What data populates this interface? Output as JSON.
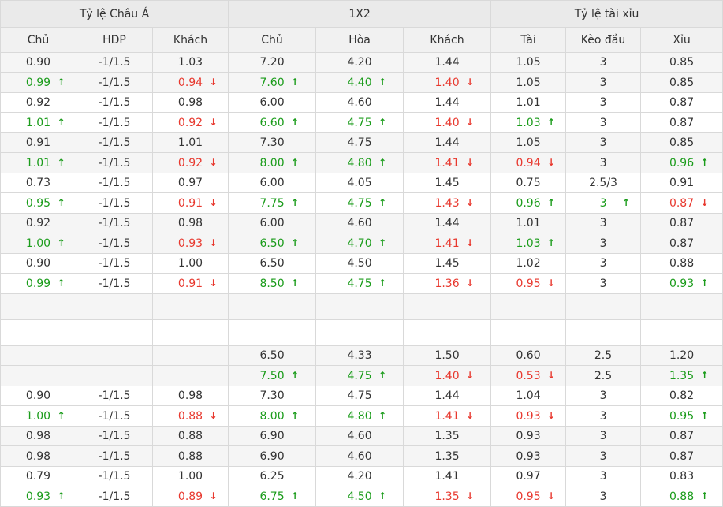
{
  "groups": [
    {
      "label": "Tỷ lệ Châu Á"
    },
    {
      "label": "1X2"
    },
    {
      "label": "Tỷ lệ tài xỉu"
    }
  ],
  "headers": [
    "Chủ",
    "HDP",
    "Khách",
    "Chủ",
    "Hòa",
    "Khách",
    "Tài",
    "Kèo đầu",
    "Xỉu"
  ],
  "arrow_glyphs": {
    "up": "🡑",
    "down": "🡓"
  },
  "colors": {
    "up": "#1b9c1b",
    "down": "#e8392f",
    "text": "#333333",
    "row_shaded": "#f5f5f5",
    "header_bg": "#eaeaea"
  },
  "rows": [
    {
      "kind": "pair",
      "cells": [
        [
          {
            "v": "0.90"
          },
          {
            "v": "0.99",
            "d": "up"
          }
        ],
        [
          {
            "v": "-1/1.5"
          },
          {
            "v": "-1/1.5"
          }
        ],
        [
          {
            "v": "1.03"
          },
          {
            "v": "0.94",
            "d": "down"
          }
        ],
        [
          {
            "v": "7.20"
          },
          {
            "v": "7.60",
            "d": "up"
          }
        ],
        [
          {
            "v": "4.20"
          },
          {
            "v": "4.40",
            "d": "up"
          }
        ],
        [
          {
            "v": "1.44"
          },
          {
            "v": "1.40",
            "d": "down"
          }
        ],
        [
          {
            "v": "1.05"
          },
          {
            "v": "1.05"
          }
        ],
        [
          {
            "v": "3"
          },
          {
            "v": "3"
          }
        ],
        [
          {
            "v": "0.85"
          },
          {
            "v": "0.85"
          }
        ]
      ]
    },
    {
      "kind": "pair",
      "cells": [
        [
          {
            "v": "0.92"
          },
          {
            "v": "1.01",
            "d": "up"
          }
        ],
        [
          {
            "v": "-1/1.5"
          },
          {
            "v": "-1/1.5"
          }
        ],
        [
          {
            "v": "0.98"
          },
          {
            "v": "0.92",
            "d": "down"
          }
        ],
        [
          {
            "v": "6.00"
          },
          {
            "v": "6.60",
            "d": "up"
          }
        ],
        [
          {
            "v": "4.60"
          },
          {
            "v": "4.75",
            "d": "up"
          }
        ],
        [
          {
            "v": "1.44"
          },
          {
            "v": "1.40",
            "d": "down"
          }
        ],
        [
          {
            "v": "1.01"
          },
          {
            "v": "1.03",
            "d": "up"
          }
        ],
        [
          {
            "v": "3"
          },
          {
            "v": "3"
          }
        ],
        [
          {
            "v": "0.87"
          },
          {
            "v": "0.87"
          }
        ]
      ]
    },
    {
      "kind": "pair",
      "cells": [
        [
          {
            "v": "0.91"
          },
          {
            "v": "1.01",
            "d": "up"
          }
        ],
        [
          {
            "v": "-1/1.5"
          },
          {
            "v": "-1/1.5"
          }
        ],
        [
          {
            "v": "1.01"
          },
          {
            "v": "0.92",
            "d": "down"
          }
        ],
        [
          {
            "v": "7.30"
          },
          {
            "v": "8.00",
            "d": "up"
          }
        ],
        [
          {
            "v": "4.75"
          },
          {
            "v": "4.80",
            "d": "up"
          }
        ],
        [
          {
            "v": "1.44"
          },
          {
            "v": "1.41",
            "d": "down"
          }
        ],
        [
          {
            "v": "1.05"
          },
          {
            "v": "0.94",
            "d": "down"
          }
        ],
        [
          {
            "v": "3"
          },
          {
            "v": "3"
          }
        ],
        [
          {
            "v": "0.85"
          },
          {
            "v": "0.96",
            "d": "up"
          }
        ]
      ]
    },
    {
      "kind": "pair",
      "cells": [
        [
          {
            "v": "0.73"
          },
          {
            "v": "0.95",
            "d": "up"
          }
        ],
        [
          {
            "v": "-1/1.5"
          },
          {
            "v": "-1/1.5"
          }
        ],
        [
          {
            "v": "0.97"
          },
          {
            "v": "0.91",
            "d": "down"
          }
        ],
        [
          {
            "v": "6.00"
          },
          {
            "v": "7.75",
            "d": "up"
          }
        ],
        [
          {
            "v": "4.05"
          },
          {
            "v": "4.75",
            "d": "up"
          }
        ],
        [
          {
            "v": "1.45"
          },
          {
            "v": "1.43",
            "d": "down"
          }
        ],
        [
          {
            "v": "0.75"
          },
          {
            "v": "0.96",
            "d": "up"
          }
        ],
        [
          {
            "v": "2.5/3"
          },
          {
            "v": "3",
            "d": "up"
          }
        ],
        [
          {
            "v": "0.91"
          },
          {
            "v": "0.87",
            "d": "down"
          }
        ]
      ]
    },
    {
      "kind": "pair",
      "cells": [
        [
          {
            "v": "0.92"
          },
          {
            "v": "1.00",
            "d": "up"
          }
        ],
        [
          {
            "v": "-1/1.5"
          },
          {
            "v": "-1/1.5"
          }
        ],
        [
          {
            "v": "0.98"
          },
          {
            "v": "0.93",
            "d": "down"
          }
        ],
        [
          {
            "v": "6.00"
          },
          {
            "v": "6.50",
            "d": "up"
          }
        ],
        [
          {
            "v": "4.60"
          },
          {
            "v": "4.70",
            "d": "up"
          }
        ],
        [
          {
            "v": "1.44"
          },
          {
            "v": "1.41",
            "d": "down"
          }
        ],
        [
          {
            "v": "1.01"
          },
          {
            "v": "1.03",
            "d": "up"
          }
        ],
        [
          {
            "v": "3"
          },
          {
            "v": "3"
          }
        ],
        [
          {
            "v": "0.87"
          },
          {
            "v": "0.87"
          }
        ]
      ]
    },
    {
      "kind": "pair",
      "cells": [
        [
          {
            "v": "0.90"
          },
          {
            "v": "0.99",
            "d": "up"
          }
        ],
        [
          {
            "v": "-1/1.5"
          },
          {
            "v": "-1/1.5"
          }
        ],
        [
          {
            "v": "1.00"
          },
          {
            "v": "0.91",
            "d": "down"
          }
        ],
        [
          {
            "v": "6.50"
          },
          {
            "v": "8.50",
            "d": "up"
          }
        ],
        [
          {
            "v": "4.50"
          },
          {
            "v": "4.75",
            "d": "up"
          }
        ],
        [
          {
            "v": "1.45"
          },
          {
            "v": "1.36",
            "d": "down"
          }
        ],
        [
          {
            "v": "1.02"
          },
          {
            "v": "0.95",
            "d": "down"
          }
        ],
        [
          {
            "v": "3"
          },
          {
            "v": "3"
          }
        ],
        [
          {
            "v": "0.88"
          },
          {
            "v": "0.93",
            "d": "up"
          }
        ]
      ]
    },
    {
      "kind": "blank"
    },
    {
      "kind": "blank"
    },
    {
      "kind": "pair",
      "cells": [
        [
          {
            "v": ""
          },
          {
            "v": ""
          }
        ],
        [
          {
            "v": ""
          },
          {
            "v": ""
          }
        ],
        [
          {
            "v": ""
          },
          {
            "v": ""
          }
        ],
        [
          {
            "v": "6.50"
          },
          {
            "v": "7.50",
            "d": "up"
          }
        ],
        [
          {
            "v": "4.33"
          },
          {
            "v": "4.75",
            "d": "up"
          }
        ],
        [
          {
            "v": "1.50"
          },
          {
            "v": "1.40",
            "d": "down"
          }
        ],
        [
          {
            "v": "0.60"
          },
          {
            "v": "0.53",
            "d": "down"
          }
        ],
        [
          {
            "v": "2.5"
          },
          {
            "v": "2.5"
          }
        ],
        [
          {
            "v": "1.20"
          },
          {
            "v": "1.35",
            "d": "up"
          }
        ]
      ]
    },
    {
      "kind": "pair",
      "cells": [
        [
          {
            "v": "0.90"
          },
          {
            "v": "1.00",
            "d": "up"
          }
        ],
        [
          {
            "v": "-1/1.5"
          },
          {
            "v": "-1/1.5"
          }
        ],
        [
          {
            "v": "0.98"
          },
          {
            "v": "0.88",
            "d": "down"
          }
        ],
        [
          {
            "v": "7.30"
          },
          {
            "v": "8.00",
            "d": "up"
          }
        ],
        [
          {
            "v": "4.75"
          },
          {
            "v": "4.80",
            "d": "up"
          }
        ],
        [
          {
            "v": "1.44"
          },
          {
            "v": "1.41",
            "d": "down"
          }
        ],
        [
          {
            "v": "1.04"
          },
          {
            "v": "0.93",
            "d": "down"
          }
        ],
        [
          {
            "v": "3"
          },
          {
            "v": "3"
          }
        ],
        [
          {
            "v": "0.82"
          },
          {
            "v": "0.95",
            "d": "up"
          }
        ]
      ]
    },
    {
      "kind": "pair",
      "cells": [
        [
          {
            "v": "0.98"
          },
          {
            "v": "0.98"
          }
        ],
        [
          {
            "v": "-1/1.5"
          },
          {
            "v": "-1/1.5"
          }
        ],
        [
          {
            "v": "0.88"
          },
          {
            "v": "0.88"
          }
        ],
        [
          {
            "v": "6.90"
          },
          {
            "v": "6.90"
          }
        ],
        [
          {
            "v": "4.60"
          },
          {
            "v": "4.60"
          }
        ],
        [
          {
            "v": "1.35"
          },
          {
            "v": "1.35"
          }
        ],
        [
          {
            "v": "0.93"
          },
          {
            "v": "0.93"
          }
        ],
        [
          {
            "v": "3"
          },
          {
            "v": "3"
          }
        ],
        [
          {
            "v": "0.87"
          },
          {
            "v": "0.87"
          }
        ]
      ]
    },
    {
      "kind": "pair",
      "cells": [
        [
          {
            "v": "0.79"
          },
          {
            "v": "0.93",
            "d": "up"
          }
        ],
        [
          {
            "v": "-1/1.5"
          },
          {
            "v": "-1/1.5"
          }
        ],
        [
          {
            "v": "1.00"
          },
          {
            "v": "0.89",
            "d": "down"
          }
        ],
        [
          {
            "v": "6.25"
          },
          {
            "v": "6.75",
            "d": "up"
          }
        ],
        [
          {
            "v": "4.20"
          },
          {
            "v": "4.50",
            "d": "up"
          }
        ],
        [
          {
            "v": "1.41"
          },
          {
            "v": "1.35",
            "d": "down"
          }
        ],
        [
          {
            "v": "0.97"
          },
          {
            "v": "0.95",
            "d": "down"
          }
        ],
        [
          {
            "v": "3"
          },
          {
            "v": "3"
          }
        ],
        [
          {
            "v": "0.83"
          },
          {
            "v": "0.88",
            "d": "up"
          }
        ]
      ]
    }
  ]
}
